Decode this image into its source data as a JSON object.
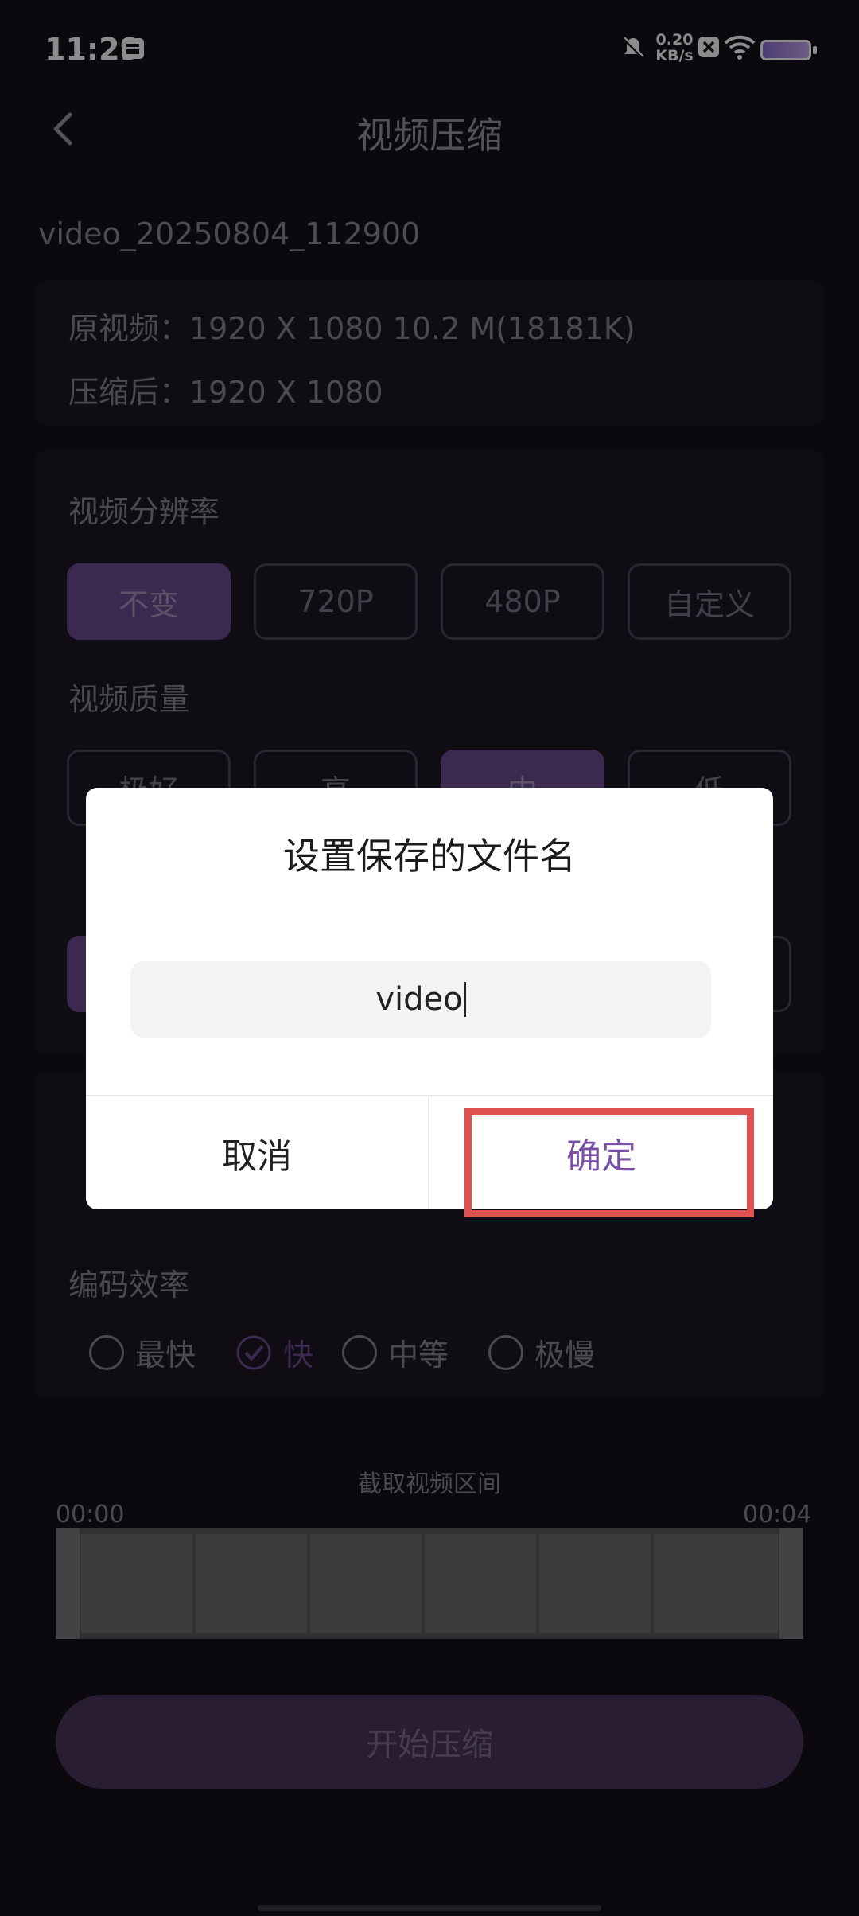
{
  "status_bar": {
    "time": "11:29",
    "net_speed_value": "0.20",
    "net_speed_unit": "KB/s"
  },
  "header": {
    "title": "视频压缩"
  },
  "file": {
    "name": "video_20250804_112900"
  },
  "info": {
    "original": "原视频：1920 X 1080 10.2 M(18181K)",
    "compressed": "压缩后：1920 X 1080"
  },
  "resolution": {
    "label": "视频分辨率",
    "options": [
      "不变",
      "720P",
      "480P",
      "自定义"
    ],
    "selected": "不变"
  },
  "quality": {
    "label": "视频质量",
    "options": [
      "极好",
      "高",
      "中",
      "低"
    ],
    "selected": "中"
  },
  "efficiency": {
    "label": "编码效率",
    "options": [
      "最快",
      "快",
      "中等",
      "极慢"
    ],
    "selected": "快"
  },
  "trim": {
    "label": "截取视频区间",
    "start": "00:00",
    "end": "00:04"
  },
  "start_button": "开始压缩",
  "dialog": {
    "title": "设置保存的文件名",
    "input_value": "video",
    "cancel": "取消",
    "confirm": "确定"
  },
  "colors": {
    "accent": "#6e4b93",
    "confirm_text": "#7a4fa6",
    "highlight": "#e05151"
  }
}
